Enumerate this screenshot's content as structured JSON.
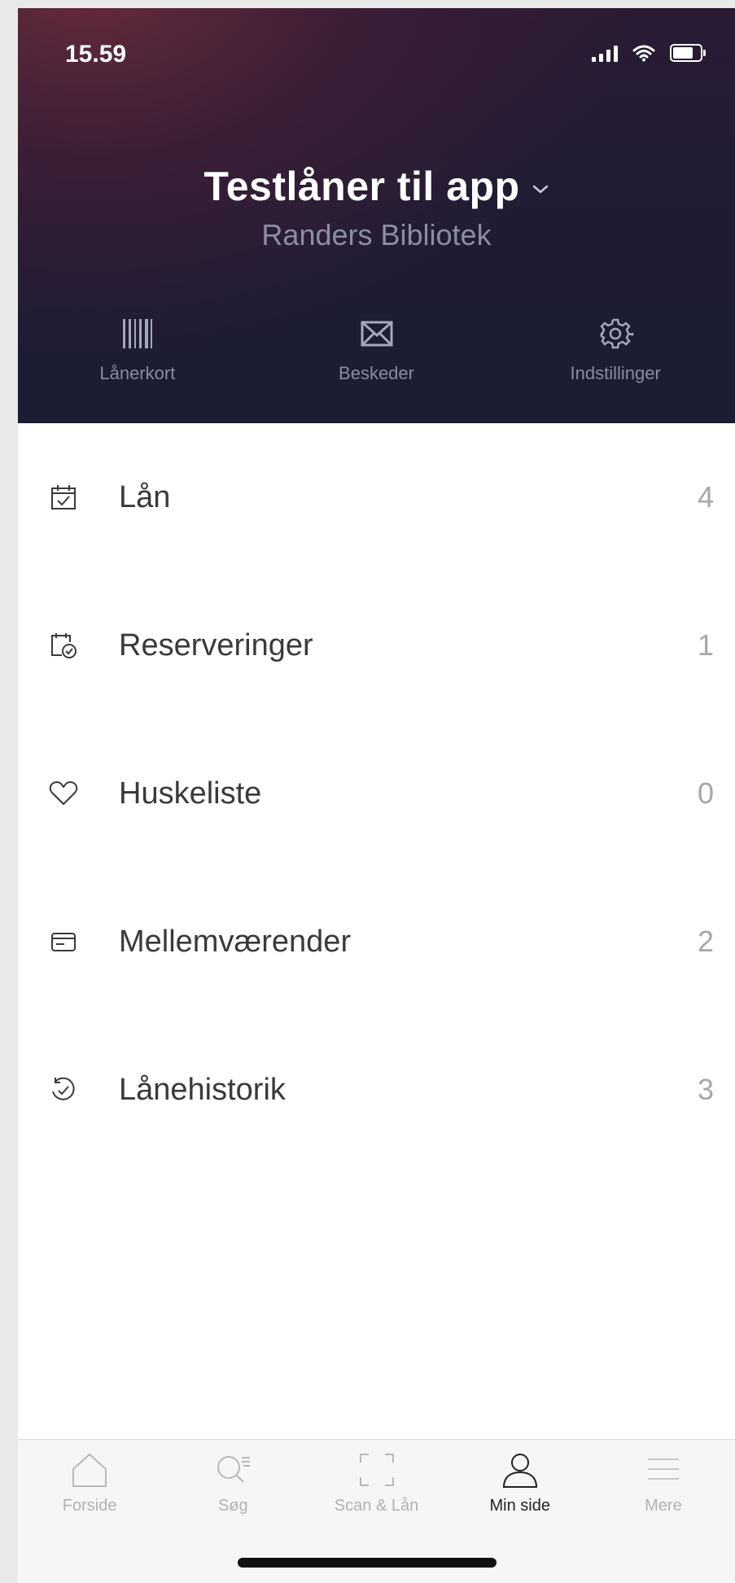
{
  "status": {
    "time": "15.59"
  },
  "account": {
    "title": "Testlåner til app",
    "library": "Randers Bibliotek"
  },
  "header_actions": [
    {
      "label": "Lånerkort",
      "icon": "barcode-icon"
    },
    {
      "label": "Beskeder",
      "icon": "mail-icon"
    },
    {
      "label": "Indstillinger",
      "icon": "gear-icon"
    }
  ],
  "menu": [
    {
      "label": "Lån",
      "count": "4",
      "icon": "calendar-check-icon"
    },
    {
      "label": "Reserveringer",
      "count": "1",
      "icon": "reservation-icon"
    },
    {
      "label": "Huskeliste",
      "count": "0",
      "icon": "heart-icon"
    },
    {
      "label": "Mellemværender",
      "count": "2",
      "icon": "card-icon"
    },
    {
      "label": "Lånehistorik",
      "count": "3",
      "icon": "history-icon"
    }
  ],
  "tabbar": [
    {
      "label": "Forside",
      "icon": "home-icon",
      "active": false
    },
    {
      "label": "Søg",
      "icon": "search-icon",
      "active": false
    },
    {
      "label": "Scan & Lån",
      "icon": "scan-icon",
      "active": false
    },
    {
      "label": "Min side",
      "icon": "user-icon",
      "active": true
    },
    {
      "label": "Mere",
      "icon": "menu-icon",
      "active": false
    }
  ],
  "colors": {
    "header_dark": "#1d1c33",
    "header_accent": "#6a2c3c",
    "text": "#3a3a3c",
    "muted": "#a7a7aa"
  }
}
